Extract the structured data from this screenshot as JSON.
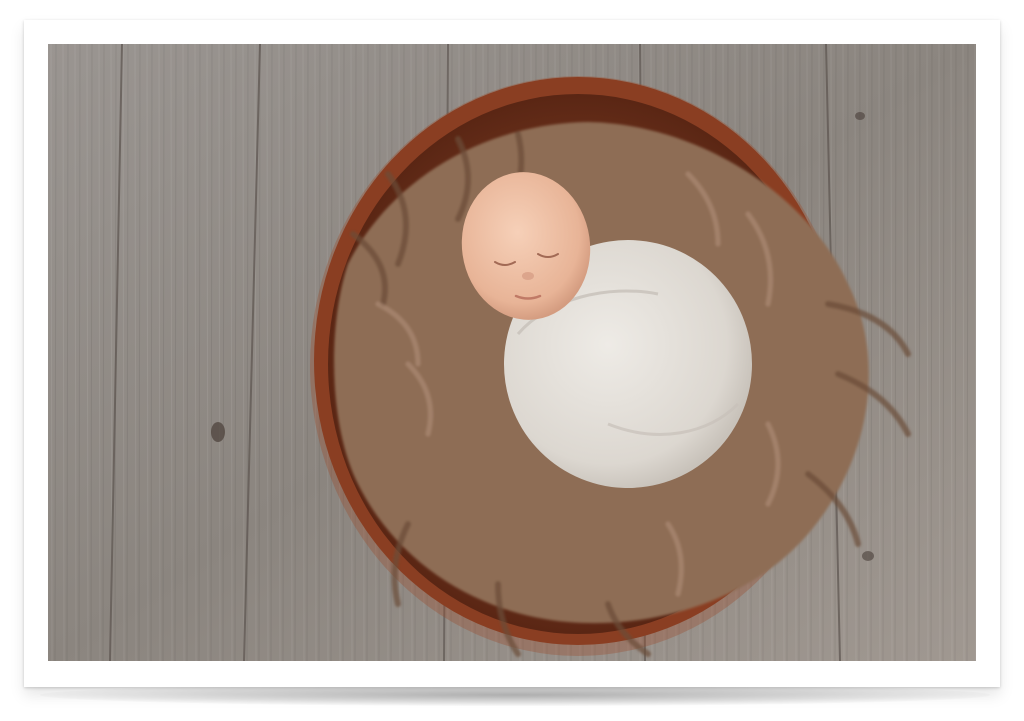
{
  "photo": {
    "subject": "sleeping-newborn-in-wooden-bowl",
    "colors": {
      "wood_floor": "#8f8a86",
      "plank_line": "#5f5752",
      "bowl_rim": "#8a3e22",
      "bowl_inner": "#6e2f1b",
      "fur": "#8a6a52",
      "fur_light": "#b0907a",
      "swaddle": "#e6e2dc",
      "skin": "#f0c2a8"
    }
  }
}
